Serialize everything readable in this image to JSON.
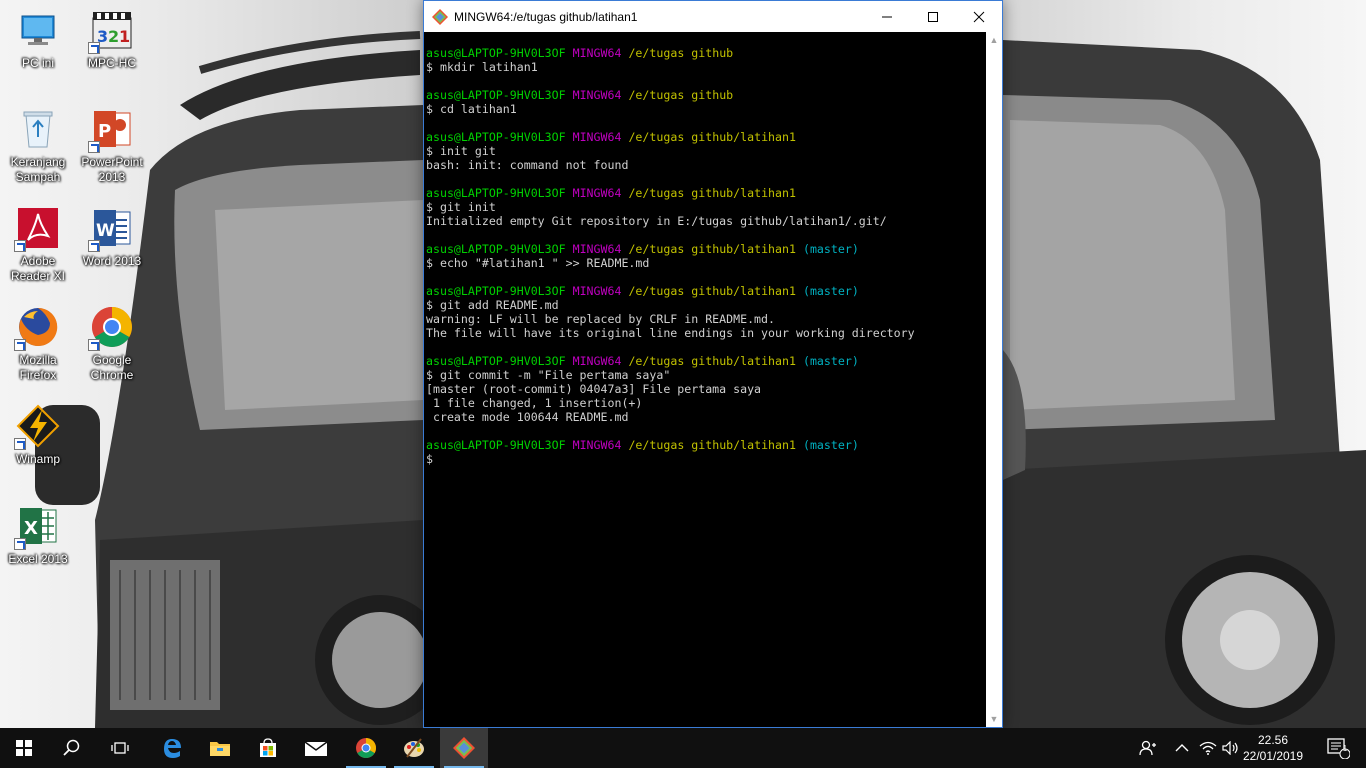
{
  "desktop": {
    "icons": [
      {
        "label": "PC ini",
        "icon": "computer-icon"
      },
      {
        "label": "MPC-HC",
        "icon": "mpc-hc-icon"
      },
      {
        "label": "Keranjang Sampah",
        "icon": "recycle-bin-icon"
      },
      {
        "label": "PowerPoint 2013",
        "icon": "powerpoint-icon"
      },
      {
        "label": "Adobe Reader XI",
        "icon": "adobe-reader-icon"
      },
      {
        "label": "Word 2013",
        "icon": "word-icon"
      },
      {
        "label": "Mozilla Firefox",
        "icon": "firefox-icon"
      },
      {
        "label": "Google Chrome",
        "icon": "chrome-icon"
      },
      {
        "label": "Winamp",
        "icon": "winamp-icon"
      },
      {
        "label": "Excel 2013",
        "icon": "excel-icon"
      }
    ]
  },
  "terminal": {
    "title": "MINGW64:/e/tugas github/latihan1",
    "colors": {
      "user": "#00d000",
      "system": "#c000c0",
      "path": "#c0c000",
      "branch": "#00b0c0",
      "output": "#d0d0d0"
    },
    "prompt_user": "asus@LAPTOP-9HV0L3OF",
    "prompt_system": "MINGW64",
    "blocks": [
      {
        "path": "/e/tugas github",
        "branch": "",
        "command": "$ mkdir latihan1",
        "output": []
      },
      {
        "path": "/e/tugas github",
        "branch": "",
        "command": "$ cd latihan1",
        "output": []
      },
      {
        "path": "/e/tugas github/latihan1",
        "branch": "",
        "command": "$ init git",
        "output": [
          "bash: init: command not found"
        ]
      },
      {
        "path": "/e/tugas github/latihan1",
        "branch": "",
        "command": "$ git init",
        "output": [
          "Initialized empty Git repository in E:/tugas github/latihan1/.git/"
        ]
      },
      {
        "path": "/e/tugas github/latihan1",
        "branch": "(master)",
        "command": "$ echo \"#latihan1 \" >> README.md",
        "output": []
      },
      {
        "path": "/e/tugas github/latihan1",
        "branch": "(master)",
        "command": "$ git add README.md",
        "output": [
          "warning: LF will be replaced by CRLF in README.md.",
          "The file will have its original line endings in your working directory"
        ]
      },
      {
        "path": "/e/tugas github/latihan1",
        "branch": "(master)",
        "command": "$ git commit -m \"File pertama saya\"",
        "output": [
          "[master (root-commit) 04047a3] File pertama saya",
          " 1 file changed, 1 insertion(+)",
          " create mode 100644 README.md"
        ]
      },
      {
        "path": "/e/tugas github/latihan1",
        "branch": "(master)",
        "command": "$",
        "output": []
      }
    ]
  },
  "taskbar": {
    "items": [
      "start-icon",
      "search-icon",
      "task-view-icon",
      "edge-icon",
      "file-explorer-icon",
      "store-icon",
      "mail-icon",
      "chrome-icon",
      "paint-icon",
      "git-bash-icon"
    ],
    "clock": {
      "time": "22.56",
      "date": "22/01/2019"
    },
    "notification_count": "1"
  }
}
